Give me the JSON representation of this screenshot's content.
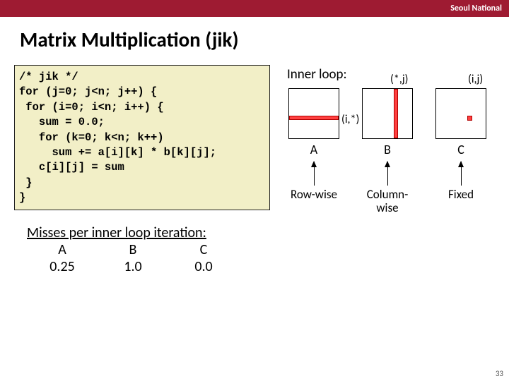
{
  "header": {
    "org": "Seoul National"
  },
  "title": "Matrix Multiplication (jik)",
  "code": "/* jik */\nfor (j=0; j<n; j++) {\n for (i=0; i<n; i++) {\n   sum = 0.0;\n   for (k=0; k<n; k++)\n     sum += a[i][k] * b[k][j];\n   c[i][j] = sum\n }\n}",
  "inner_label": "Inner loop:",
  "matrices": {
    "A": {
      "name": "A",
      "annot": "(i,*)",
      "caption": "Row-wise"
    },
    "B": {
      "name": "B",
      "annot": "(*,j)",
      "caption": "Column-\nwise"
    },
    "C": {
      "name": "C",
      "annot": "(i,j)",
      "caption": "Fixed"
    }
  },
  "misses": {
    "title": "Misses per inner loop iteration:",
    "cols": [
      "A",
      "B",
      "C"
    ],
    "vals": [
      "0.25",
      "1.0",
      "0.0"
    ]
  },
  "page": "33"
}
